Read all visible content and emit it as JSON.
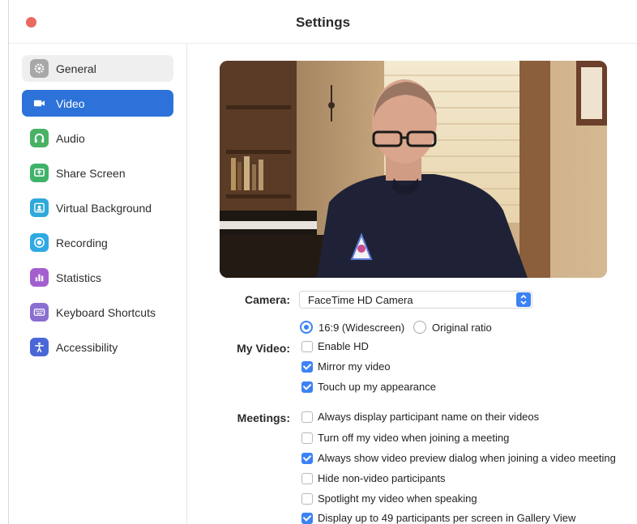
{
  "window": {
    "title": "Settings"
  },
  "sidebar": {
    "items": [
      {
        "label": "General",
        "icon": "gear-icon",
        "state": "hover"
      },
      {
        "label": "Video",
        "icon": "video-camera-icon",
        "state": "active"
      },
      {
        "label": "Audio",
        "icon": "headphones-icon",
        "state": ""
      },
      {
        "label": "Share Screen",
        "icon": "share-screen-icon",
        "state": ""
      },
      {
        "label": "Virtual Background",
        "icon": "person-background-icon",
        "state": ""
      },
      {
        "label": "Recording",
        "icon": "record-icon",
        "state": ""
      },
      {
        "label": "Statistics",
        "icon": "bar-chart-icon",
        "state": ""
      },
      {
        "label": "Keyboard Shortcuts",
        "icon": "keyboard-icon",
        "state": ""
      },
      {
        "label": "Accessibility",
        "icon": "accessibility-icon",
        "state": ""
      }
    ]
  },
  "camera": {
    "label": "Camera:",
    "selected": "FaceTime HD Camera"
  },
  "my_video": {
    "label": "My Video:",
    "ratio_options": [
      {
        "label": "16:9 (Widescreen)",
        "selected": true
      },
      {
        "label": "Original ratio",
        "selected": false
      }
    ],
    "options": [
      {
        "label": "Enable HD",
        "checked": false
      },
      {
        "label": "Mirror my video",
        "checked": true
      },
      {
        "label": "Touch up my appearance",
        "checked": true
      }
    ]
  },
  "meetings": {
    "label": "Meetings:",
    "options": [
      {
        "label": "Always display participant name on their videos",
        "checked": false
      },
      {
        "label": "Turn off my video when joining a meeting",
        "checked": false
      },
      {
        "label": "Always show video preview dialog when joining a video meeting",
        "checked": true
      },
      {
        "label": "Hide non-video participants",
        "checked": false
      },
      {
        "label": "Spotlight my video when speaking",
        "checked": false
      },
      {
        "label": "Display up to 49 participants per screen in Gallery View",
        "checked": true
      }
    ]
  },
  "colors": {
    "accent": "#2d72d9",
    "checkbox": "#3b82f6",
    "close_button": "#e96b5f"
  }
}
